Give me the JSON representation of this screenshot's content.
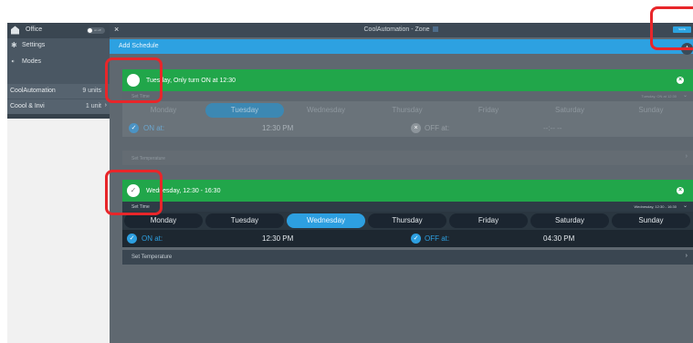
{
  "sidebar": {
    "location": "Office",
    "toggle_label": "on off",
    "menu": [
      {
        "icon": "gear-icon",
        "label": "Settings"
      },
      {
        "icon": "modes-icon",
        "label": "Modes"
      }
    ],
    "systems": [
      {
        "name": "CoolAutomation",
        "count": "9 units"
      },
      {
        "name": "Coool & Invi",
        "count": "1 unit"
      }
    ]
  },
  "topbar": {
    "close": "×",
    "title": "CoolAutomation - Zone",
    "save_label": "SAVE"
  },
  "add_schedule": {
    "label": "Add Schedule",
    "plus": "+"
  },
  "schedules": [
    {
      "title": "Tuesday, Only turn ON at 12:30",
      "set_time_label": "Set Time",
      "set_time_value": "Tuesday, ON at 12:30",
      "days": [
        "Monday",
        "Tuesday",
        "Wednesday",
        "Thursday",
        "Friday",
        "Saturday",
        "Sunday"
      ],
      "active_day": "Tuesday",
      "on_label": "ON at:",
      "on_time": "12:30 PM",
      "off_label": "OFF at:",
      "off_time": "--:-- --",
      "set_temp_label": "Set Temperature",
      "checkbox_mark": ""
    },
    {
      "title": "Wednesday, 12:30 - 16:30",
      "set_time_label": "Set Time",
      "set_time_value": "Wednesday, 12:30 - 16:30",
      "days": [
        "Monday",
        "Tuesday",
        "Wednesday",
        "Thursday",
        "Friday",
        "Saturday",
        "Sunday"
      ],
      "active_day": "Wednesday",
      "on_label": "ON at:",
      "on_time": "12:30 PM",
      "off_label": "OFF at:",
      "off_time": "04:30 PM",
      "set_temp_label": "Set Temperature",
      "checkbox_mark": "✓"
    }
  ],
  "colors": {
    "header_green": "#21a64a",
    "accent_blue": "#2da1e1",
    "highlight_red": "#e8262a",
    "sidebar_dark": "#4a5763"
  }
}
